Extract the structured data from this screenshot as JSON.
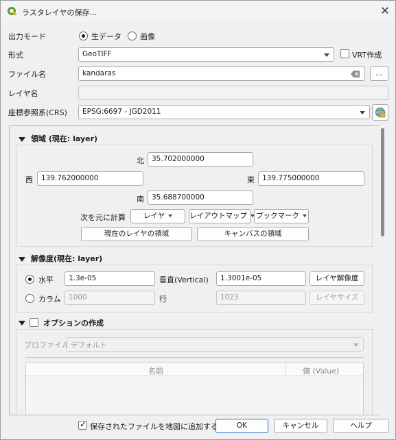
{
  "window": {
    "title": "ラスタレイヤの保存...",
    "close": "✕"
  },
  "output_mode": {
    "label": "出力モード",
    "options": [
      "生データ",
      "画像"
    ],
    "selected": "生データ"
  },
  "format": {
    "label": "形式",
    "value": "GeoTIFF",
    "vrt_label": "VRT作成",
    "vrt_checked": false
  },
  "filename": {
    "label": "ファイル名",
    "value": "kandaras",
    "browse": "…"
  },
  "layer_name": {
    "label": "レイヤ名",
    "value": ""
  },
  "crs": {
    "label": "座標参照系(CRS)",
    "value": "EPSG:6697 - JGD2011"
  },
  "extent": {
    "title": "領域 (現在: layer)",
    "north_label": "北",
    "north": "35.702000000",
    "west_label": "西",
    "west": "139.762000000",
    "east_label": "東",
    "east": "139.775000000",
    "south_label": "南",
    "south": "35.688700000",
    "calc_label": "次を元に計算",
    "calc_buttons": [
      "レイヤ",
      "レイアウトマップ",
      "ブックマーク"
    ],
    "current_layer_extent": "現在のレイヤの領域",
    "canvas_extent": "キャンバスの領域"
  },
  "resolution": {
    "title": "解像度(現在: layer)",
    "horizontal_label": "水平",
    "horizontal": "1.3e-05",
    "vertical_label": "垂直(Vertical)",
    "vertical": "1.3001e-05",
    "layer_resolution_btn": "レイヤ解像度",
    "columns_label": "カラム",
    "columns": "1000",
    "rows_label": "行",
    "rows": "1023",
    "layer_size_btn": "レイヤサイズ",
    "selected": "水平"
  },
  "options": {
    "title": "オプションの作成",
    "checked": false,
    "profile_label": "プロファイル",
    "profile_value": "デフォルト",
    "table_headers": [
      "名前",
      "値 (Value)"
    ]
  },
  "footer": {
    "add_to_map_label": "保存されたファイルを地図に追加する",
    "add_to_map_checked": true,
    "ok": "OK",
    "cancel": "キャンセル",
    "help": "ヘルプ"
  }
}
